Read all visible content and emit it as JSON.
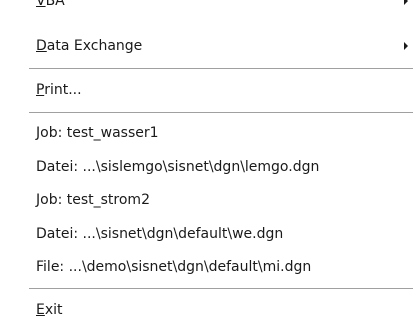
{
  "menu": {
    "vba": {
      "mnemonic": "V",
      "rest": "BA"
    },
    "data_exchange": {
      "mnemonic": "D",
      "rest": "ata Exchange"
    },
    "print": {
      "mnemonic": "P",
      "rest": "rint..."
    },
    "recent": [
      "Job: test_wasser1",
      "Datei: ...\\sislemgo\\sisnet\\dgn\\lemgo.dgn",
      "Job: test_strom2",
      "Datei: ...\\sisnet\\dgn\\default\\we.dgn",
      "File: ...\\demo\\sisnet\\dgn\\default\\mi.dgn"
    ],
    "exit": {
      "mnemonic": "E",
      "rest": "xit"
    }
  }
}
